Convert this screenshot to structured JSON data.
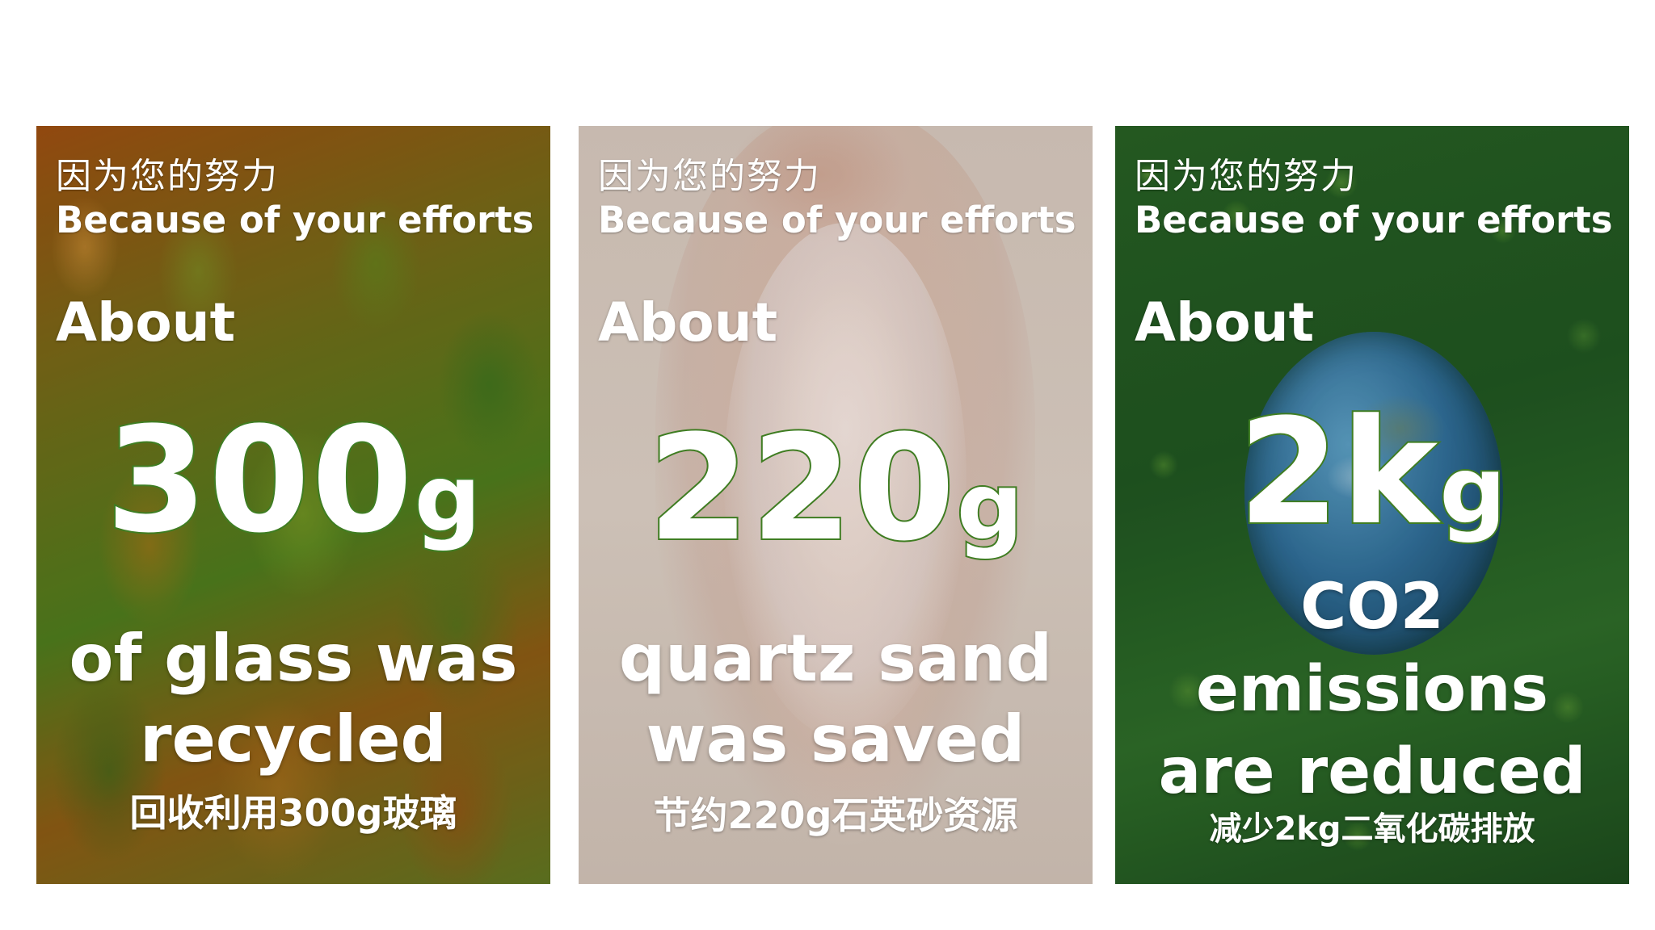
{
  "cards": [
    {
      "theme": "glass-bottles",
      "intro_cn": "因为您的努力",
      "intro_en": "Because of your efforts",
      "about": "About",
      "amount_number": "300",
      "amount_unit": "g",
      "desc_lines": [
        "of glass was",
        "recycled"
      ],
      "summary_cn": "回收利用300g玻璃"
    },
    {
      "theme": "quartz-sand-hand",
      "intro_cn": "因为您的努力",
      "intro_en": "Because of your efforts",
      "about": "About",
      "amount_number": "220",
      "amount_unit": "g",
      "desc_lines": [
        "quartz sand",
        "was saved"
      ],
      "summary_cn": "节约220g石英砂资源"
    },
    {
      "theme": "earth-forest",
      "intro_cn": "因为您的努力",
      "intro_en": "Because of your efforts",
      "about": "About",
      "amount_number": "2k",
      "amount_unit": "g",
      "desc_lines": [
        "CO2",
        "emissions",
        "are reduced"
      ],
      "summary_cn": "减少2kg二氧化碳排放"
    }
  ],
  "colors": {
    "amount_outline": "#3f7d22",
    "text": "#ffffff",
    "page_background": "#ffffff"
  }
}
